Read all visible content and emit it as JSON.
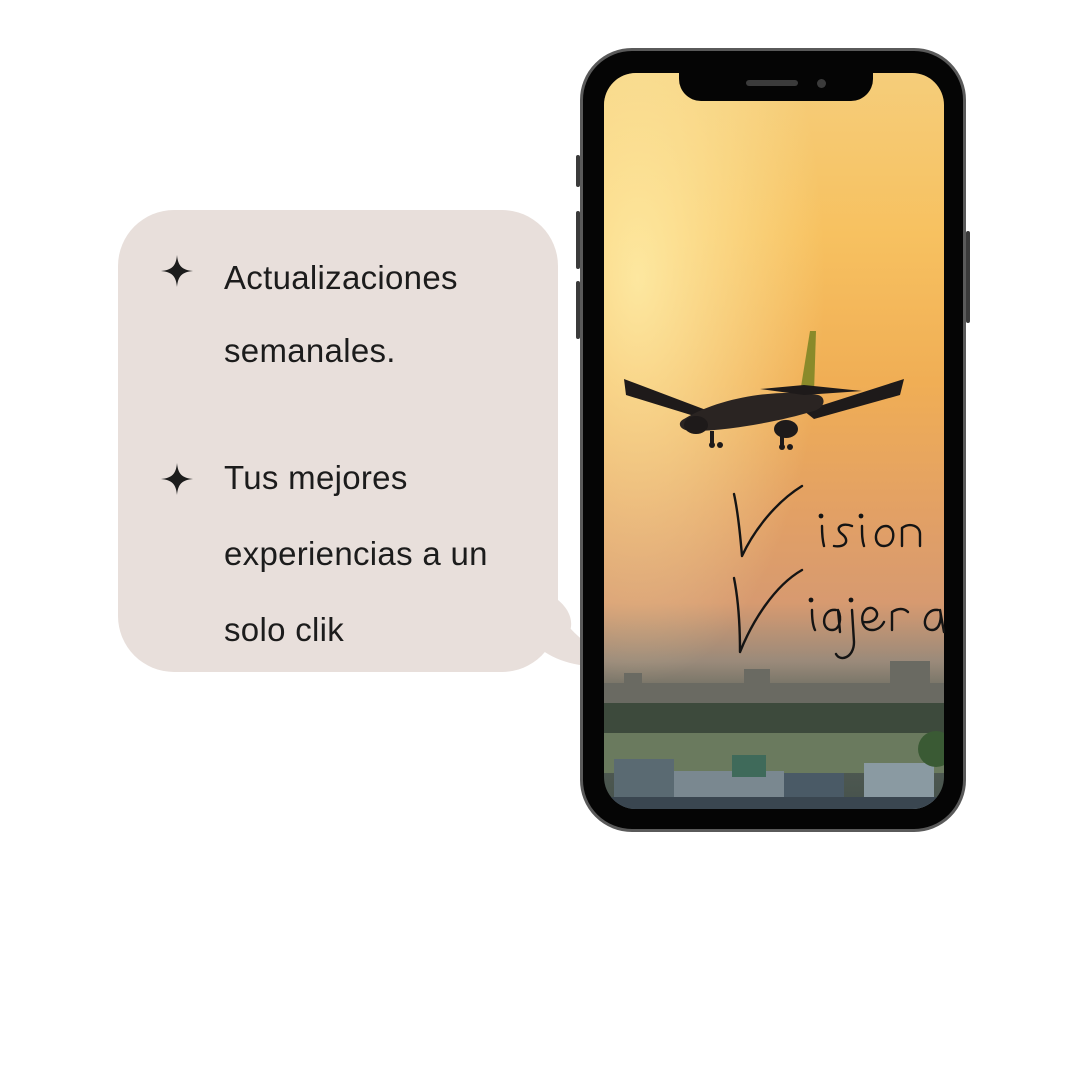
{
  "bubble": {
    "features": [
      {
        "icon": "sparkle-star-icon",
        "line1": "Actualizaciones",
        "line2": "semanales."
      },
      {
        "icon": "sparkle-star-icon",
        "line1": "Tus mejores",
        "line2": "experiencias a un",
        "line3": "solo clik"
      }
    ]
  },
  "logo": {
    "text": "Vision Viajera"
  },
  "colors": {
    "bubble": "#e8dfdb",
    "text": "#1c1c1c",
    "phone_frame": "#050505",
    "sky": "#f7c160"
  }
}
